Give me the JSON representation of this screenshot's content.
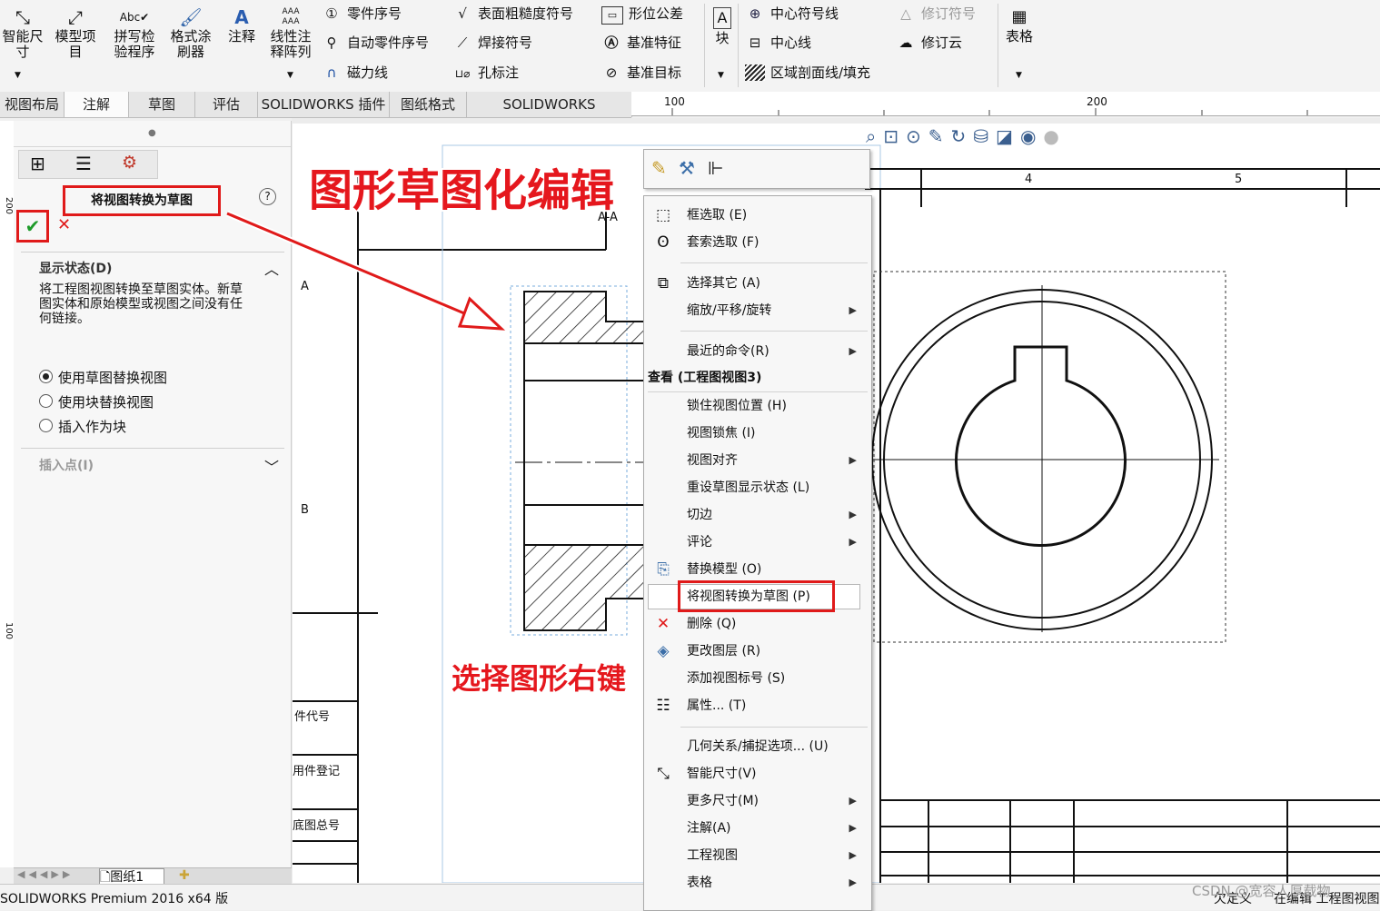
{
  "ribbon": {
    "big": [
      {
        "label": "智能尺\n寸",
        "icon": "smart-dimension-icon"
      },
      {
        "label": "模型项\n目",
        "icon": "model-items-icon"
      },
      {
        "label": "拼写检\n验程序",
        "icon": "spell-check-icon"
      },
      {
        "label": "格式涂\n刷器",
        "icon": "format-painter-icon"
      },
      {
        "label": "注释",
        "icon": "note-icon"
      },
      {
        "label": "线性注\n释阵列",
        "icon": "linear-note-pattern-icon"
      }
    ],
    "col1": [
      "零件序号",
      "自动零件序号",
      "磁力线"
    ],
    "col2": [
      "表面粗糙度符号",
      "焊接符号",
      "孔标注"
    ],
    "col3": [
      "形位公差",
      "基准特征",
      "基准目标"
    ],
    "block": "块",
    "col4": [
      "中心符号线",
      "中心线",
      "区域剖面线/填充"
    ],
    "col5": [
      "修订符号",
      "修订云"
    ],
    "table": "表格"
  },
  "tabs": [
    "视图布局",
    "注解",
    "草图",
    "评估",
    "SOLIDWORKS 插件",
    "图纸格式",
    "SOLIDWORKS Inspection"
  ],
  "ruler": {
    "top_100": "100",
    "top_200": "200",
    "left_100": "100",
    "left_200": "200"
  },
  "panel": {
    "title": "将视图转换为草图",
    "help": "?",
    "section_display": "显示状态(D)",
    "description": "将工程图视图转换至草图实体。新草图实体和原始模型或视图之间没有任何链接。",
    "options": [
      "使用草图替换视图",
      "使用块替换视图",
      "插入作为块"
    ],
    "section_insert": "插入点(I)"
  },
  "annotations": {
    "headline": "图形草图化编辑",
    "right_click": "选择图形右键"
  },
  "drawing": {
    "section_label": "A-A",
    "zone_a": "A",
    "zone_b": "B",
    "zone_4": "4",
    "zone_5": "5",
    "table_rows": [
      "件代号",
      "用件登记",
      "底图总号"
    ]
  },
  "context_menu": {
    "items": [
      {
        "label": "框选取 (E)",
        "icon": "box-select-icon",
        "arrow": false
      },
      {
        "label": "套索选取 (F)",
        "icon": "lasso-select-icon",
        "arrow": false
      },
      {
        "label": "选择其它 (A)",
        "icon": "select-other-icon",
        "arrow": false
      },
      {
        "label": "缩放/平移/旋转",
        "icon": "",
        "arrow": true
      },
      {
        "label": "最近的命令(R)",
        "icon": "",
        "arrow": true
      }
    ],
    "header": "查看 (工程图视图3)",
    "view_items": [
      {
        "label": "锁住视图位置 (H)",
        "icon": "",
        "arrow": false
      },
      {
        "label": "视图锁焦 (I)",
        "icon": "",
        "arrow": false
      },
      {
        "label": "视图对齐",
        "icon": "",
        "arrow": true
      },
      {
        "label": "重设草图显示状态 (L)",
        "icon": "",
        "arrow": false
      },
      {
        "label": "切边",
        "icon": "",
        "arrow": true
      },
      {
        "label": "评论",
        "icon": "",
        "arrow": true
      },
      {
        "label": "替换模型 (O)",
        "icon": "replace-model-icon",
        "arrow": false
      },
      {
        "label": "将视图转换为草图 (P)",
        "icon": "",
        "arrow": false
      },
      {
        "label": "删除 (Q)",
        "icon": "delete-icon",
        "arrow": false
      },
      {
        "label": "更改图层 (R)",
        "icon": "change-layer-icon",
        "arrow": false
      },
      {
        "label": "添加视图标号 (S)",
        "icon": "",
        "arrow": false
      },
      {
        "label": "属性... (T)",
        "icon": "properties-icon",
        "arrow": false
      }
    ],
    "bottom_items": [
      {
        "label": "几何关系/捕捉选项... (U)",
        "icon": "",
        "arrow": false
      },
      {
        "label": "智能尺寸(V)",
        "icon": "smart-dimension-icon",
        "arrow": false
      },
      {
        "label": "更多尺寸(M)",
        "icon": "",
        "arrow": true
      },
      {
        "label": "注解(A)",
        "icon": "",
        "arrow": true
      },
      {
        "label": "工程视图",
        "icon": "",
        "arrow": true
      },
      {
        "label": "表格",
        "icon": "",
        "arrow": true
      }
    ]
  },
  "sheet_tab": "图纸1",
  "status": {
    "left": "SOLIDWORKS Premium 2016 x64 版",
    "right1": "欠定义",
    "right2": "在编辑 工程图视图",
    "watermark": "CSDN @宽容人厚载物"
  }
}
